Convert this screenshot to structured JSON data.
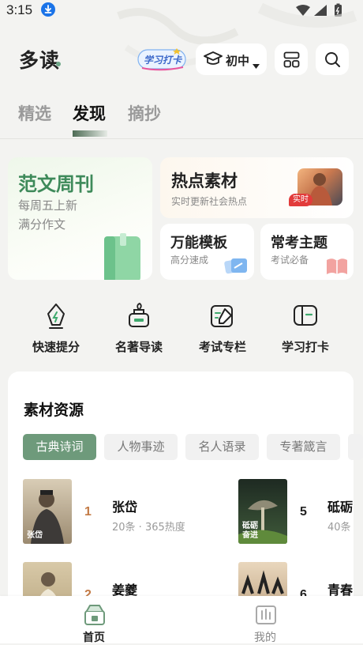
{
  "status_bar": {
    "time": "3:15"
  },
  "header": {
    "app_name": "多读",
    "checkin_badge": "学习打卡",
    "grade": "初中"
  },
  "tabs": [
    {
      "label": "精选",
      "active": false
    },
    {
      "label": "发现",
      "active": true
    },
    {
      "label": "摘抄",
      "active": false
    }
  ],
  "cards": {
    "weekly": {
      "title": "范文周刊",
      "line1": "每周五上新",
      "line2": "满分作文"
    },
    "hot": {
      "title": "热点素材",
      "subtitle": "实时更新社会热点",
      "tag": "实时"
    },
    "template": {
      "title": "万能模板",
      "subtitle": "高分速成"
    },
    "topic": {
      "title": "常考主题",
      "subtitle": "考试必备"
    }
  },
  "quick_actions": [
    {
      "label": "快速提分",
      "icon": "pen-nib-icon"
    },
    {
      "label": "名著导读",
      "icon": "ink-bottle-icon"
    },
    {
      "label": "考试专栏",
      "icon": "edit-note-icon"
    },
    {
      "label": "学习打卡",
      "icon": "checkin-card-icon"
    }
  ],
  "resources": {
    "title": "素材资源",
    "chips": [
      "古典诗词",
      "人物事迹",
      "名人语录",
      "专著箴言"
    ],
    "active_chip": "古典诗词",
    "items": [
      {
        "rank": "1",
        "name": "张岱",
        "meta": "20条 · 365热度",
        "thumb_caption": "张岱"
      },
      {
        "rank": "2",
        "name": "姜夔",
        "meta": ""
      },
      {
        "rank": "5",
        "name": "砥砺",
        "meta": "40条",
        "thumb_caption": "砥砺 奋进"
      },
      {
        "rank": "6",
        "name": "青春",
        "meta": ""
      }
    ]
  },
  "bottom_nav": [
    {
      "label": "首页",
      "active": true
    },
    {
      "label": "我的",
      "active": false
    }
  ],
  "colors": {
    "accent_green": "#6e9a7b",
    "title_green": "#3e8a5a",
    "rank_hot": "#c37a45",
    "tag_red": "#e23b3b"
  }
}
